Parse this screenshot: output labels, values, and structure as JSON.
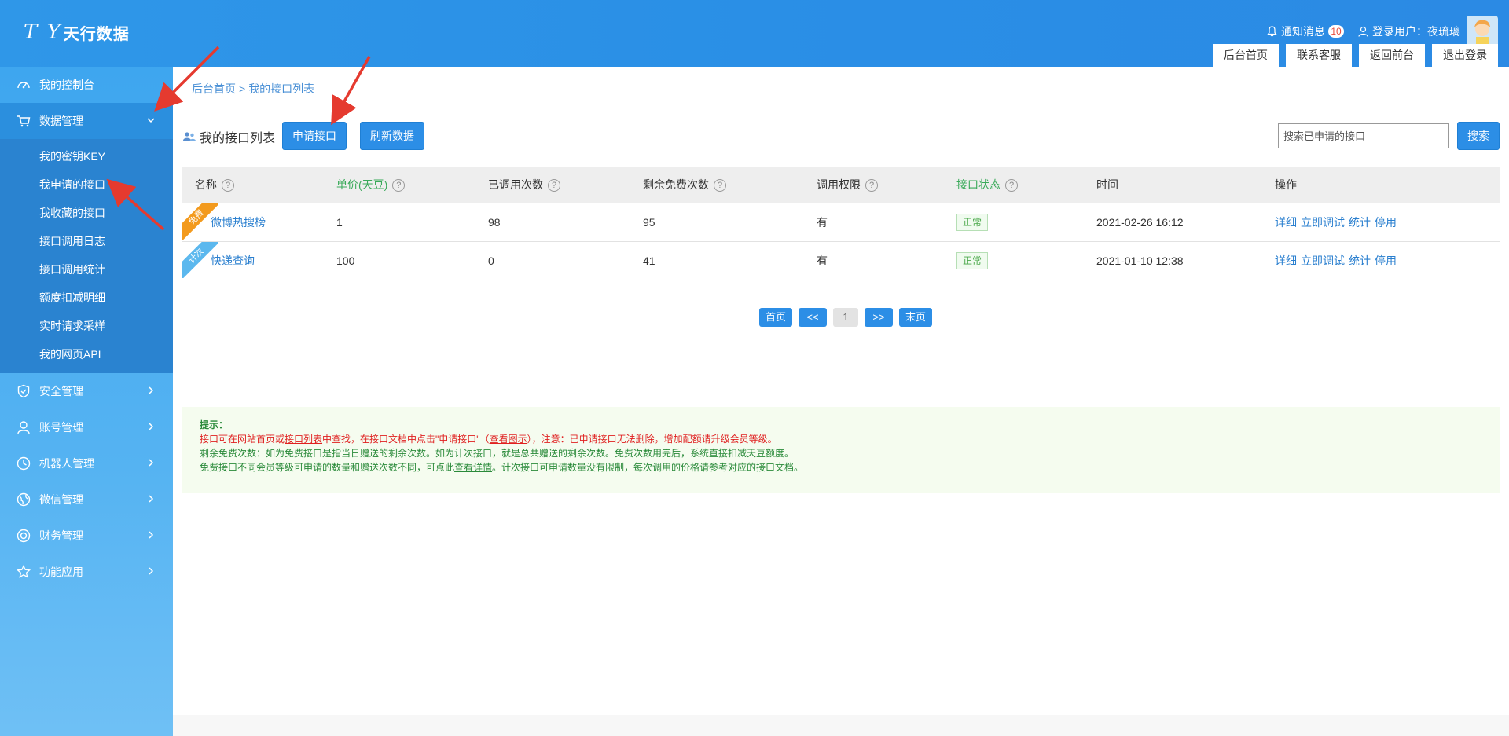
{
  "header": {
    "logo_mark": "T Y",
    "logo_text": "天行数据",
    "notify_label": "通知消息",
    "notify_count": "10",
    "user_label": "登录用户：夜琉璃",
    "tabs": [
      "后台首页",
      "联系客服",
      "返回前台",
      "退出登录"
    ]
  },
  "sidebar": {
    "items": [
      {
        "label": "我的控制台",
        "icon": "dashboard-icon"
      },
      {
        "label": "数据管理",
        "icon": "cart-icon"
      },
      {
        "label": "安全管理",
        "icon": "shield-icon"
      },
      {
        "label": "账号管理",
        "icon": "user-icon"
      },
      {
        "label": "机器人管理",
        "icon": "robot-icon"
      },
      {
        "label": "微信管理",
        "icon": "globe-icon"
      },
      {
        "label": "财务管理",
        "icon": "finance-icon"
      },
      {
        "label": "功能应用",
        "icon": "star-icon"
      }
    ],
    "submenu": [
      "我的密钥KEY",
      "我申请的接口",
      "我收藏的接口",
      "接口调用日志",
      "接口调用统计",
      "额度扣减明细",
      "实时请求采样",
      "我的网页API"
    ]
  },
  "breadcrumb": {
    "home": "后台首页",
    "sep": ">",
    "current": "我的接口列表"
  },
  "toolbar": {
    "title": "我的接口列表",
    "apply_label": "申请接口",
    "refresh_label": "刷新数据",
    "search_placeholder": "搜索已申请的接口",
    "search_label": "搜索"
  },
  "table": {
    "headers": [
      "名称",
      "单价(天豆)",
      "已调用次数",
      "剩余免费次数",
      "调用权限",
      "接口状态",
      "时间",
      "操作"
    ],
    "rows": [
      {
        "tag": "免费",
        "name": "微博热搜榜",
        "price": "1",
        "called": "98",
        "remaining": "95",
        "permission": "有",
        "status": "正常",
        "time": "2021-02-26 16:12"
      },
      {
        "tag": "计次",
        "name": "快递查询",
        "price": "100",
        "called": "0",
        "remaining": "41",
        "permission": "有",
        "status": "正常",
        "time": "2021-01-10 12:38"
      }
    ],
    "ops": [
      "详细",
      "立即调试",
      "统计",
      "停用"
    ]
  },
  "pager": {
    "first": "首页",
    "prev": "<<",
    "page": "1",
    "next": ">>",
    "last": "末页"
  },
  "tips": {
    "title": "提示：",
    "line1_a": "接口可在网站首页或",
    "line1_link1": "接口列表",
    "line1_b": "中查找，在接口文档中点击\"申请接口\"（",
    "line1_link2": "查看图示",
    "line1_c": "），注意：已申请接口无法删除，增加配额请升级会员等级。",
    "line2": "剩余免费次数：如为免费接口是指当日赠送的剩余次数。如为计次接口，就是总共赠送的剩余次数。免费次数用完后，系统直接扣减天豆额度。",
    "line3_a": "免费接口不同会员等级可申请的数量和赠送次数不同，可点此",
    "line3_link": "查看详情",
    "line3_b": "。计次接口可申请数量没有限制，每次调用的价格请参考对应的接口文档。"
  },
  "colors": {
    "accent": "#2c8ee6",
    "status_green": "#4aa84a",
    "arrow_red": "#e53a2f"
  }
}
